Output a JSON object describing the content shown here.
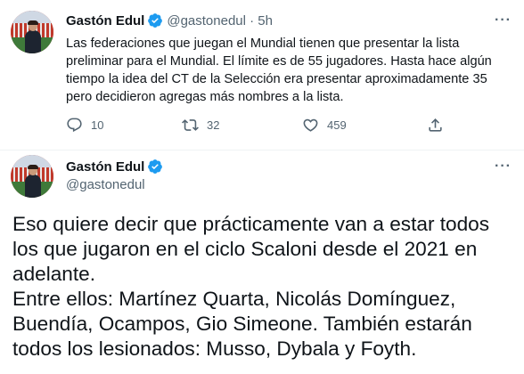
{
  "tweet1": {
    "author_name": "Gastón Edul",
    "handle_time": "@gastonedul · 5h",
    "text": "Las federaciones que juegan el Mundial tienen que presentar la lista preliminar para el Mundial. El límite es de 55 jugadores. Hasta hace algún tiempo la idea del CT de la Selección era presentar aproximadamente 35 pero decidieron agregas más nombres a la lista.",
    "actions": {
      "reply_count": "10",
      "retweet_count": "32",
      "like_count": "459"
    }
  },
  "tweet2": {
    "author_name": "Gastón Edul",
    "handle": "@gastonedul",
    "paragraph1": "Eso quiere decir que prácticamente van a estar todos los que jugaron en el ciclo Scaloni desde el 2021 en adelante.",
    "paragraph2": "Entre ellos: Martínez Quarta, Nicolás Domínguez, Buendía, Ocampos, Gio Simeone. También estarán todos los lesionados: Musso, Dybala y Foyth."
  },
  "icons": {
    "verified": "verified-badge-icon",
    "more": "more-options-icon",
    "reply": "reply-icon",
    "retweet": "retweet-icon",
    "like": "like-icon",
    "share": "share-icon"
  },
  "colors": {
    "verified_blue": "#1d9bf0",
    "secondary_text": "#536471",
    "primary_text": "#0f1419"
  }
}
